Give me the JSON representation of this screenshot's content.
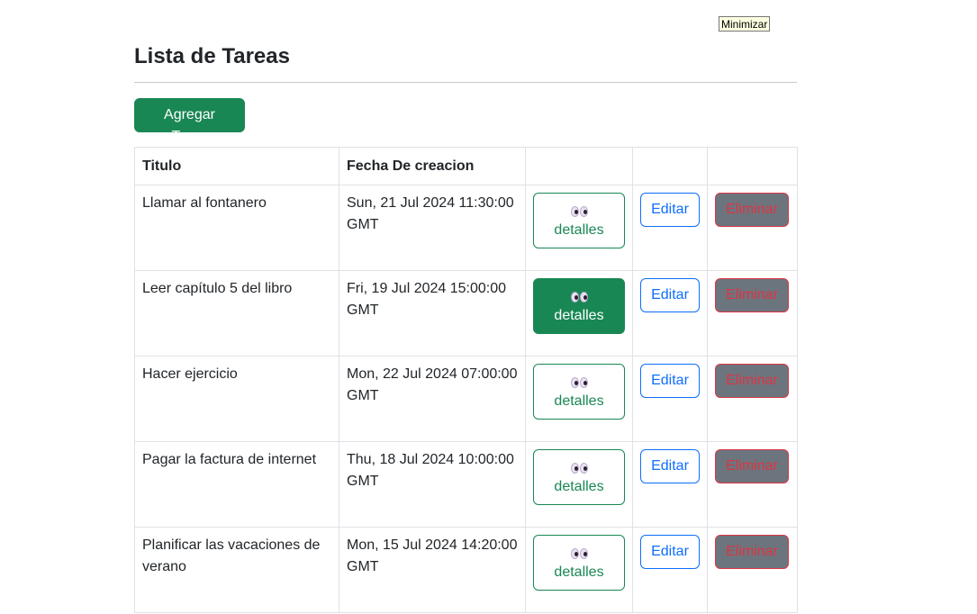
{
  "tooltip": {
    "text": "Minimizar"
  },
  "page": {
    "title": "Lista de Tareas",
    "add_button_label": "Agregar Tarea"
  },
  "table": {
    "headers": {
      "title": "Titulo",
      "date": "Fecha De creacion",
      "col3": "",
      "col4": "",
      "col5": ""
    },
    "rows": [
      {
        "title": "Llamar al fontanero",
        "date": "Sun, 21 Jul 2024 11:30:00 GMT",
        "details_label": "detalles",
        "edit_label": "Editar",
        "delete_label": "Eliminar"
      },
      {
        "title": "Leer capítulo 5 del libro",
        "date": "Fri, 19 Jul 2024 15:00:00 GMT",
        "details_label": "detalles",
        "edit_label": "Editar",
        "delete_label": "Eliminar"
      },
      {
        "title": "Hacer ejercicio",
        "date": "Mon, 22 Jul 2024 07:00:00 GMT",
        "details_label": "detalles",
        "edit_label": "Editar",
        "delete_label": "Eliminar"
      },
      {
        "title": "Pagar la factura de internet",
        "date": "Thu, 18 Jul 2024 10:00:00 GMT",
        "details_label": "detalles",
        "edit_label": "Editar",
        "delete_label": "Eliminar"
      },
      {
        "title": "Planificar las vacaciones de verano",
        "date": "Mon, 15 Jul 2024 14:20:00 GMT",
        "details_label": "detalles",
        "edit_label": "Editar",
        "delete_label": "Eliminar"
      }
    ]
  },
  "icons": {
    "details_icon": "eyes-icon"
  },
  "colors": {
    "success": "#198754",
    "primary": "#0d6efd",
    "danger": "#dc3545",
    "secondary": "#6c757d"
  }
}
